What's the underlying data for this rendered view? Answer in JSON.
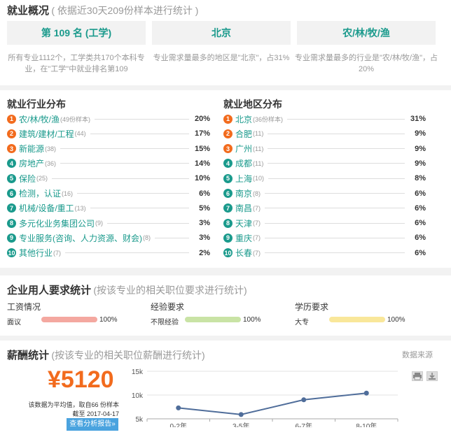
{
  "overview": {
    "title": "就业概况",
    "subtitle": "( 依据近30天209份样本进行统计 )",
    "boxes": [
      {
        "value": "第 109 名 (工学)",
        "desc": "所有专业1112个，工学类共170个本科专业，在\"工学\"中就业排名第109"
      },
      {
        "value": "北京",
        "desc": "专业需求量最多的地区是\"北京\"，占31%"
      },
      {
        "value": "农/林/牧/渔",
        "desc": "专业需求量最多的行业是\"农/林/牧/渔\"，占20%"
      }
    ]
  },
  "industry": {
    "title": "就业行业分布",
    "items": [
      {
        "rank": "1",
        "name": "农/林/牧/渔",
        "count": "(49份样本)",
        "pct": "20%"
      },
      {
        "rank": "2",
        "name": "建筑/建材/工程",
        "count": "(44)",
        "pct": "17%"
      },
      {
        "rank": "3",
        "name": "新能源",
        "count": "(38)",
        "pct": "15%"
      },
      {
        "rank": "4",
        "name": "房地产",
        "count": "(36)",
        "pct": "14%"
      },
      {
        "rank": "5",
        "name": "保险",
        "count": "(25)",
        "pct": "10%"
      },
      {
        "rank": "6",
        "name": "检测，认证",
        "count": "(16)",
        "pct": "6%"
      },
      {
        "rank": "7",
        "name": "机械/设备/重工",
        "count": "(13)",
        "pct": "5%"
      },
      {
        "rank": "8",
        "name": "多元化业务集团公司",
        "count": "(9)",
        "pct": "3%"
      },
      {
        "rank": "9",
        "name": "专业服务(咨询、人力资源、财会)",
        "count": "(8)",
        "pct": "3%"
      },
      {
        "rank": "10",
        "name": "其他行业",
        "count": "(7)",
        "pct": "2%"
      }
    ]
  },
  "region": {
    "title": "就业地区分布",
    "items": [
      {
        "rank": "1",
        "name": "北京",
        "count": "(36份样本)",
        "pct": "31%"
      },
      {
        "rank": "2",
        "name": "合肥",
        "count": "(11)",
        "pct": "9%"
      },
      {
        "rank": "3",
        "name": "广州",
        "count": "(11)",
        "pct": "9%"
      },
      {
        "rank": "4",
        "name": "成都",
        "count": "(11)",
        "pct": "9%"
      },
      {
        "rank": "5",
        "name": "上海",
        "count": "(10)",
        "pct": "8%"
      },
      {
        "rank": "6",
        "name": "南京",
        "count": "(8)",
        "pct": "6%"
      },
      {
        "rank": "7",
        "name": "南昌",
        "count": "(7)",
        "pct": "6%"
      },
      {
        "rank": "8",
        "name": "天津",
        "count": "(7)",
        "pct": "6%"
      },
      {
        "rank": "9",
        "name": "重庆",
        "count": "(7)",
        "pct": "6%"
      },
      {
        "rank": "10",
        "name": "长春",
        "count": "(7)",
        "pct": "6%"
      }
    ]
  },
  "requirements": {
    "title": "企业用人要求统计",
    "subtitle": "(按该专业的相关职位要求进行统计)",
    "groups": [
      {
        "label": "工资情况",
        "value": "面议",
        "pct": "100%",
        "fraction": 1.0,
        "color": "#f4a8a0"
      },
      {
        "label": "经验要求",
        "value": "不限经验",
        "pct": "100%",
        "fraction": 1.0,
        "color": "#c9e3a5"
      },
      {
        "label": "学历要求",
        "value": "大专",
        "pct": "100%",
        "fraction": 1.0,
        "color": "#f9e79a"
      }
    ]
  },
  "salary": {
    "title": "薪酬统计",
    "subtitle": "(按该专业的相关职位薪酬进行统计)",
    "source": "数据来源",
    "amount": "¥5120",
    "note1": "该数据为平均值，取自66 份样本",
    "note2": "截至 2017-04-17",
    "button": "查看分析报告»",
    "chart_data": {
      "type": "line",
      "categories": [
        "0-2年",
        "3-5年",
        "6-7年",
        "8-10年"
      ],
      "values": [
        7300,
        5900,
        9000,
        10400
      ],
      "y_ticks": [
        "5k",
        "10k",
        "15k"
      ],
      "ylim": [
        5000,
        15000
      ],
      "line_color": "#4f6d9a",
      "grid": true
    }
  }
}
